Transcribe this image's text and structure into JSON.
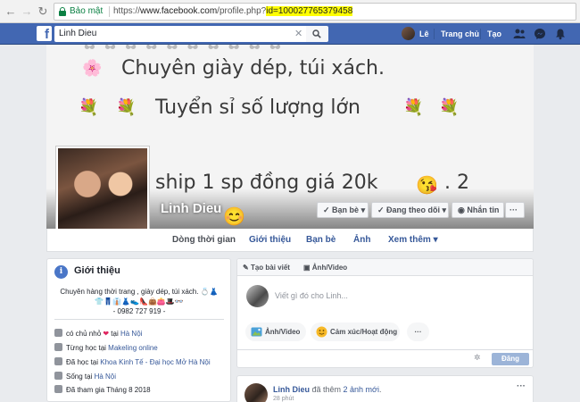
{
  "browser": {
    "back_icon": "arrow-left-icon",
    "forward_icon": "arrow-right-icon",
    "reload_icon": "reload-icon",
    "secure_label": "Bảo mật",
    "url_scheme": "https://",
    "url_host": "www.facebook.com",
    "url_path": "/profile.php?",
    "url_query": "id=100027765379458"
  },
  "fbbar": {
    "logo": "f",
    "search_value": "Linh Dieu",
    "search_clear": "✕",
    "user_name": "Lê",
    "home_label": "Trang chủ",
    "create_label": "Tạo"
  },
  "cover": {
    "line1": "Chuyên giày dép, túi xách.",
    "line2": "Tuyển sỉ số lượng lớn",
    "line3": "ship 1 sp đồng giá 20k",
    "line3_suffix": ". 2",
    "profile_name": "Linh Dieu",
    "friends_button": "Bạn bè",
    "following_button": "Đang theo dõi",
    "message_button": "Nhắn tin",
    "more_button": "···"
  },
  "tabs": [
    {
      "label": "Dòng thời gian"
    },
    {
      "label": "Giới thiệu"
    },
    {
      "label": "Bạn bè"
    },
    {
      "label": "Ảnh"
    },
    {
      "label": "Xem thêm"
    }
  ],
  "intro": {
    "title": "Giới thiệu",
    "bio_line1": "Chuyên hàng thời trang , giày dép, túi xách. 💍👗",
    "bio_line2": "👕👖👔👗👟👠👜👛🎩👓",
    "bio_line3": "- 0982 727 919 -",
    "row1_pre": "có chủ nhỏ ",
    "row1_heart": "❤",
    "row1_mid": " tại ",
    "row1_link": "Hà Nội",
    "row2_pre": "Từng học tại ",
    "row2_link": "Makeling online",
    "row3_pre": "Đã học tại ",
    "row3_link": "Khoa Kinh Tế - Đại học Mở Hà Nội",
    "row4_pre": "Sống tại ",
    "row4_link": "Hà Nội",
    "row5": "Đã tham gia Tháng 8 2018"
  },
  "composer": {
    "tab_post": "Tạo bài viết",
    "tab_photo": "Ảnh/Video",
    "placeholder": "Viết gì đó cho Linh...",
    "chip_photo": "Ảnh/Video",
    "chip_feeling": "Cảm xúc/Hoạt động",
    "chip_more": "···",
    "post_button": "Đăng"
  },
  "post": {
    "author": "Linh Dieu",
    "action_pre": " đã thêm ",
    "action_link": "2 ảnh mới",
    "action_post": ".",
    "time": "28 phút",
    "menu": "···"
  },
  "colors": {
    "fb_blue": "#4267b2",
    "link": "#365899",
    "highlight": "#ffff00",
    "secure_green": "#0b8043"
  }
}
